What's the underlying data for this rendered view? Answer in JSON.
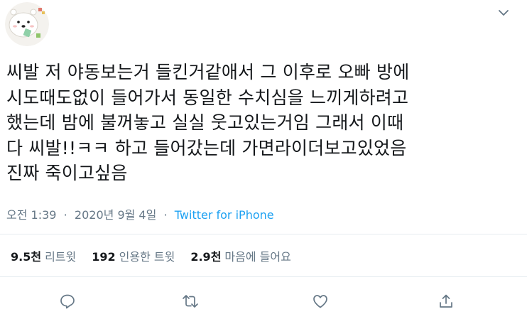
{
  "tweet": {
    "lines": [
      "씨발 저 야동보는거 들킨거같애서 그 이후로 오빠 방에",
      "시도때도없이 들어가서 동일한 수치심을 느끼게하려고",
      "했는데 밤에 불꺼놓고 실실 웃고있는거임 그래서 이때",
      "다 씨발!!ㅋㅋ 하고 들어갔는데 가면라이더보고있었음",
      "진짜 죽이고싶음"
    ],
    "time": "오전 1:39",
    "separator": "·",
    "date": "2020년 9월 4일",
    "source": "Twitter for iPhone"
  },
  "stats": {
    "retweets": {
      "count": "9.5천",
      "label": "리트윗"
    },
    "quotes": {
      "count": "192",
      "label": "인용한 트윗"
    },
    "likes": {
      "count": "2.9천",
      "label": "마음에 들어요"
    }
  },
  "icons": {
    "avatar": "polar-bear-avatar",
    "menu": "chevron-down-icon",
    "reply": "reply-icon",
    "retweet": "retweet-icon",
    "like": "heart-icon",
    "share": "share-icon"
  },
  "colors": {
    "text": "#14171a",
    "muted": "#657786",
    "link": "#1da1f2",
    "divider": "#e6ecf0"
  }
}
